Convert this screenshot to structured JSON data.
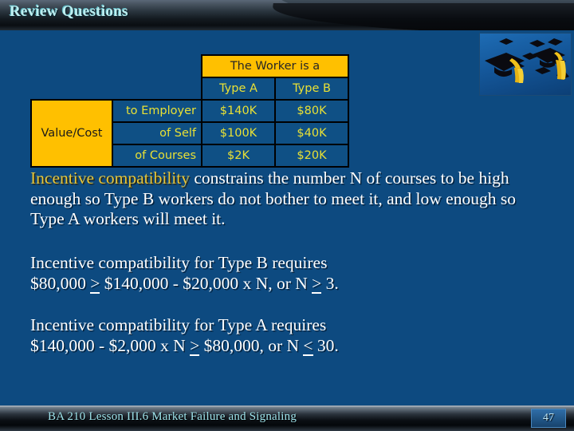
{
  "header": {
    "title": "Review Questions"
  },
  "photo": {
    "alt_name": "graduation-caps-photo"
  },
  "table": {
    "spanner_header": "The Worker is a",
    "column_headers": [
      "Type A",
      "Type B"
    ],
    "group_label": "Value/Cost",
    "rows": [
      {
        "label": "to Employer",
        "type_a": "$140K",
        "type_b": "$80K"
      },
      {
        "label": "of Self",
        "type_a": "$100K",
        "type_b": "$40K"
      },
      {
        "label": "of Courses",
        "type_a": "$2K",
        "type_b": "$20K"
      }
    ]
  },
  "body": {
    "p1_highlight": "Incentive compatibility",
    "p1_rest": " constrains the number N of courses to be high enough so Type B workers do not bother to meet it, and low enough so Type A workers will meet it.",
    "p2_line1": "Incentive compatibility for Type B requires",
    "p2_line2_a": "$80,000 ",
    "p2_ge1": ">",
    "p2_line2_b": " $140,000 - $20,000 x N, or N ",
    "p2_ge2": ">",
    "p2_line2_c": " 3.",
    "p3_line1": "Incentive compatibility for Type A requires",
    "p3_line2_a": "$140,000 - $2,000 x N ",
    "p3_ge1": ">",
    "p3_line2_b": " $80,000, or N ",
    "p3_le1": "<",
    "p3_line2_c": " 30."
  },
  "footer": {
    "text": "BA 210  Lesson III.6 Market Failure and Signaling",
    "page_number": "47"
  },
  "colors": {
    "slide_background": "#0d4a80",
    "accent_gold": "#FFC000",
    "table_cell_blue": "#0f5085",
    "table_text_yellow": "#E8E035",
    "title_cyan": "#bdeef0",
    "body_white": "#FFFFFF",
    "highlight_gold": "#E5C63C"
  }
}
